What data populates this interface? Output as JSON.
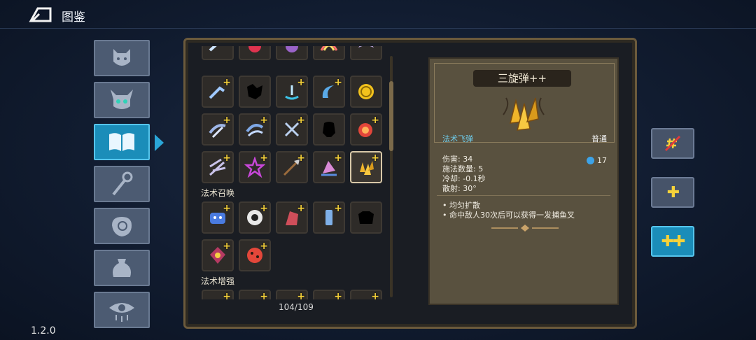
{
  "header": {
    "title": "图鉴",
    "version": "1.2.0"
  },
  "side_tabs": [
    {
      "icon": "demon-face-icon"
    },
    {
      "icon": "horned-skull-icon"
    },
    {
      "icon": "spellbook-icon",
      "active": true
    },
    {
      "icon": "staff-icon"
    },
    {
      "icon": "relic-hand-icon"
    },
    {
      "icon": "pouch-icon"
    },
    {
      "icon": "eye-icon"
    }
  ],
  "grid": {
    "sections": [
      "法术召唤",
      "法术增强"
    ],
    "page_count": "104/109",
    "plus_mark": "+"
  },
  "detail": {
    "name": "三旋弹++",
    "type": "法术飞弹",
    "rarity": "普通",
    "stats": [
      "伤害: 34",
      "施法数量: 5",
      "冷却: -0.1秒",
      "散射: 30°"
    ],
    "mana": "17",
    "effects": [
      "均匀扩散",
      "命中敌人30次后可以获得一发捕鱼叉"
    ],
    "bullet_mark": "•"
  },
  "upgrades": [
    {
      "label": "",
      "icon": "no-upgrade-icon"
    },
    {
      "label": "✚",
      "icon": "plus-icon"
    },
    {
      "label": "✚✚",
      "icon": "double-plus-icon",
      "active": true
    }
  ],
  "colors": {
    "accent": "#1b8db9",
    "panel": "#59513f",
    "gold": "#f6d23a",
    "mana": "#3da3e8"
  }
}
